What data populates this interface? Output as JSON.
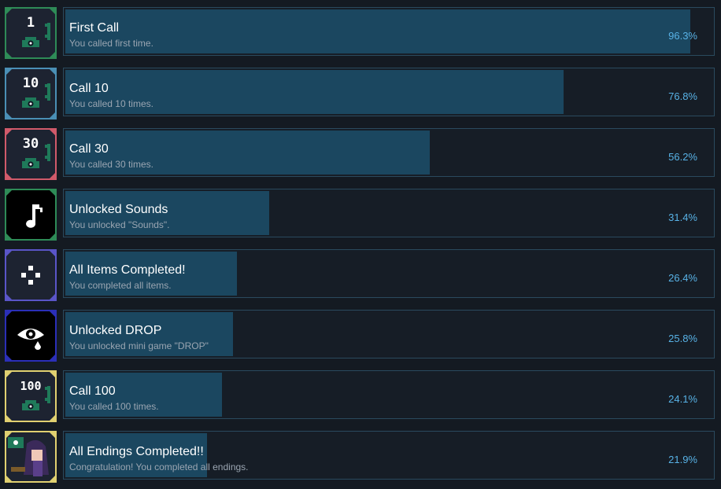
{
  "achievements": [
    {
      "title": "First Call",
      "description": "You called first time.",
      "percent": "96.3%",
      "fill": 0.963,
      "icon": "phone-1-icon",
      "icon_text": "1",
      "frame_color": "#2e8b57",
      "icon_bg": "#1d2331"
    },
    {
      "title": "Call 10",
      "description": "You called 10 times.",
      "percent": "76.8%",
      "fill": 0.768,
      "icon": "phone-10-icon",
      "icon_text": "10",
      "frame_color": "#4a8fb5",
      "icon_bg": "#1d2331"
    },
    {
      "title": "Call 30",
      "description": "You called 30 times.",
      "percent": "56.2%",
      "fill": 0.562,
      "icon": "phone-30-icon",
      "icon_text": "30",
      "frame_color": "#d05a6a",
      "icon_bg": "#1d2331"
    },
    {
      "title": "Unlocked Sounds",
      "description": "You unlocked \"Sounds\".",
      "percent": "31.4%",
      "fill": 0.314,
      "icon": "music-note-icon",
      "icon_text": "",
      "frame_color": "#2e8b57",
      "icon_bg": "#000000"
    },
    {
      "title": "All Items Completed!",
      "description": "You completed all items.",
      "percent": "26.4%",
      "fill": 0.264,
      "icon": "dpad-icon",
      "icon_text": "",
      "frame_color": "#5a55c8",
      "icon_bg": "#1d2331"
    },
    {
      "title": "Unlocked DROP",
      "description": "You unlocked mini game \"DROP\"",
      "percent": "25.8%",
      "fill": 0.258,
      "icon": "eye-drop-icon",
      "icon_text": "",
      "frame_color": "#2b2fb8",
      "icon_bg": "#000000"
    },
    {
      "title": "Call 100",
      "description": "You called 100 times.",
      "percent": "24.1%",
      "fill": 0.241,
      "icon": "phone-100-icon",
      "icon_text": "100",
      "frame_color": "#e0d070",
      "icon_bg": "#1d2331"
    },
    {
      "title": "All Endings Completed!!",
      "description": "Congratulation! You completed all endings.",
      "percent": "21.9%",
      "fill": 0.219,
      "icon": "character-portrait-icon",
      "icon_text": "",
      "frame_color": "#e0d070",
      "icon_bg": "#1d2331"
    }
  ],
  "colors": {
    "background": "#141a22",
    "panel": "#161d26",
    "panel_border": "#2a4a5e",
    "progress_fill": "#1b4760",
    "title": "#ffffff",
    "description": "#9aa5b1",
    "percent": "#58b2e6",
    "phone_green": "#1f7a5a"
  }
}
